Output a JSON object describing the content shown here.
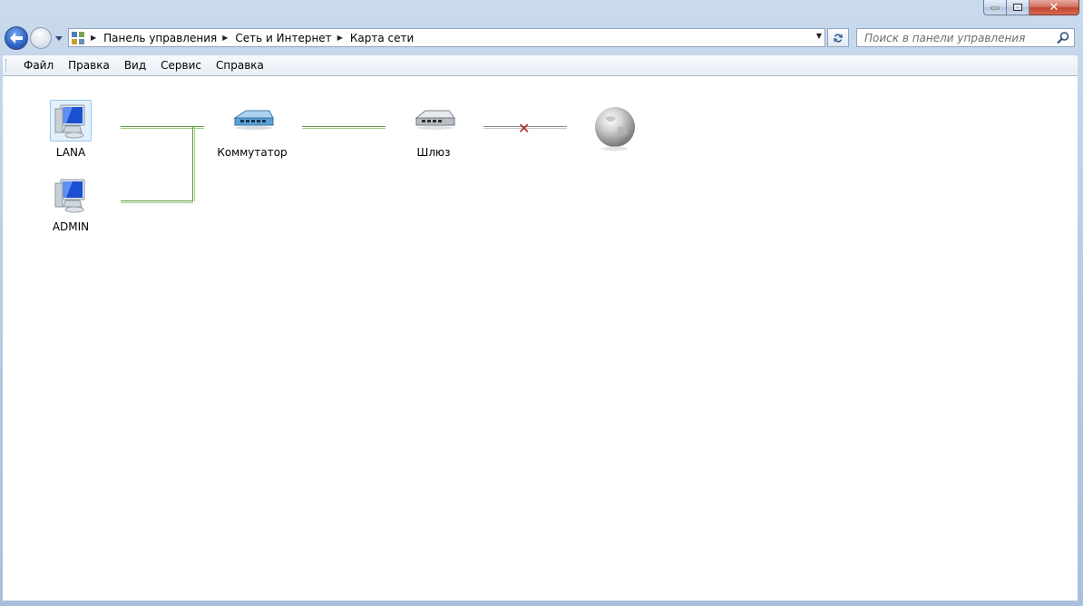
{
  "window": {
    "caption_buttons": {
      "minimize": "minimize-icon",
      "maximize": "maximize-icon",
      "close": "close-icon",
      "close_glyph": "✕"
    },
    "accent": "#2a62c6",
    "close_color": "#c2452f"
  },
  "nav": {
    "back_icon": "back-arrow-icon",
    "forward_icon": "forward-arrow-icon",
    "recent_icon": "chevron-down-icon",
    "breadcrumb": [
      "Панель управления",
      "Сеть и Интернет",
      "Карта сети"
    ],
    "search_placeholder": "Поиск в панели управления"
  },
  "menu": [
    "Файл",
    "Правка",
    "Вид",
    "Сервис",
    "Справка"
  ],
  "network_map": {
    "wire_color": "#5d9a3a",
    "broken_link_color": "#b32020",
    "nodes": [
      {
        "id": "lana",
        "label": "LANA",
        "icon": "computer-icon",
        "selected": true
      },
      {
        "id": "admin",
        "label": "ADMIN",
        "icon": "computer-icon",
        "selected": false
      },
      {
        "id": "switch",
        "label": "Коммутатор",
        "icon": "switch-icon"
      },
      {
        "id": "gateway",
        "label": "Шлюз",
        "icon": "router-icon"
      },
      {
        "id": "internet",
        "label": "",
        "icon": "globe-icon"
      }
    ],
    "links": [
      {
        "from": "lana",
        "to": "switch",
        "status": "ok"
      },
      {
        "from": "admin",
        "to": "switch",
        "status": "ok"
      },
      {
        "from": "switch",
        "to": "gateway",
        "status": "ok"
      },
      {
        "from": "gateway",
        "to": "internet",
        "status": "broken"
      }
    ]
  }
}
